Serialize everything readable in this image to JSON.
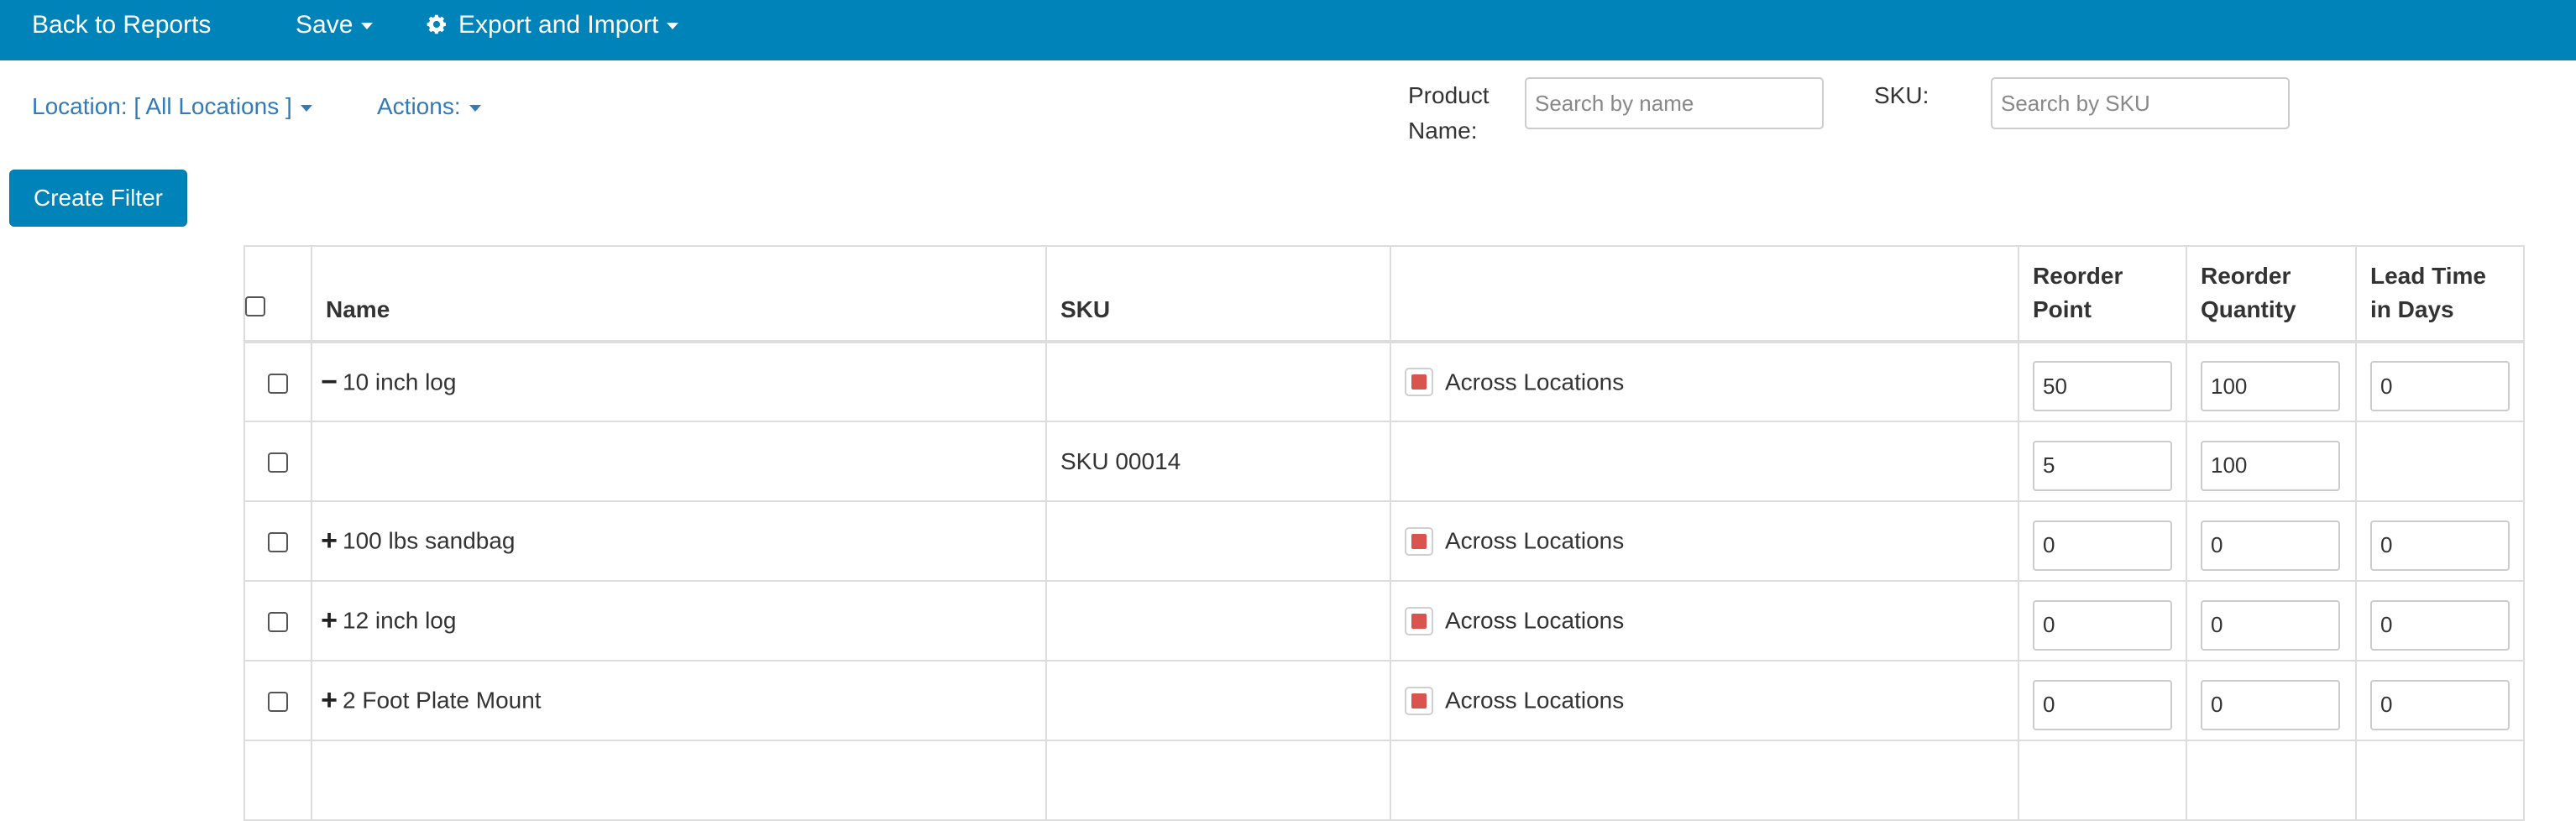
{
  "topbar": {
    "back": "Back to Reports",
    "save": "Save",
    "export": "Export and Import"
  },
  "toolbar": {
    "location": "Location: [ All Locations ]",
    "actions": "Actions:",
    "product_name_label": "Product Name:",
    "product_name_placeholder": "Search by name",
    "sku_label": "SKU:",
    "sku_placeholder": "Search by SKU",
    "create_filter": "Create Filter"
  },
  "table": {
    "headers": {
      "name": "Name",
      "sku": "SKU",
      "location": "",
      "reorder_point": "Reorder Point",
      "reorder_quantity": "Reorder Quantity",
      "lead_time": "Lead Time in Days"
    },
    "rows": [
      {
        "toggle": "−",
        "name": "10 inch log",
        "sku": "",
        "location": "Across Locations",
        "reorder_point": "50",
        "reorder_quantity": "100",
        "lead_time": "0"
      },
      {
        "toggle": "",
        "name": "",
        "sku": "SKU 00014",
        "location": "",
        "reorder_point": "5",
        "reorder_quantity": "100",
        "lead_time": ""
      },
      {
        "toggle": "+",
        "name": "100 lbs sandbag",
        "sku": "",
        "location": "Across Locations",
        "reorder_point": "0",
        "reorder_quantity": "0",
        "lead_time": "0"
      },
      {
        "toggle": "+",
        "name": "12 inch log",
        "sku": "",
        "location": "Across Locations",
        "reorder_point": "0",
        "reorder_quantity": "0",
        "lead_time": "0"
      },
      {
        "toggle": "+",
        "name": "2 Foot Plate Mount",
        "sku": "",
        "location": "Across Locations",
        "reorder_point": "0",
        "reorder_quantity": "0",
        "lead_time": "0"
      },
      {
        "toggle": "",
        "name": "",
        "sku": "",
        "location": "",
        "reorder_point": "",
        "reorder_quantity": "",
        "lead_time": ""
      }
    ]
  },
  "colors": {
    "brand": "#0083b8",
    "link": "#337ab7",
    "flag": "#d9534f"
  }
}
